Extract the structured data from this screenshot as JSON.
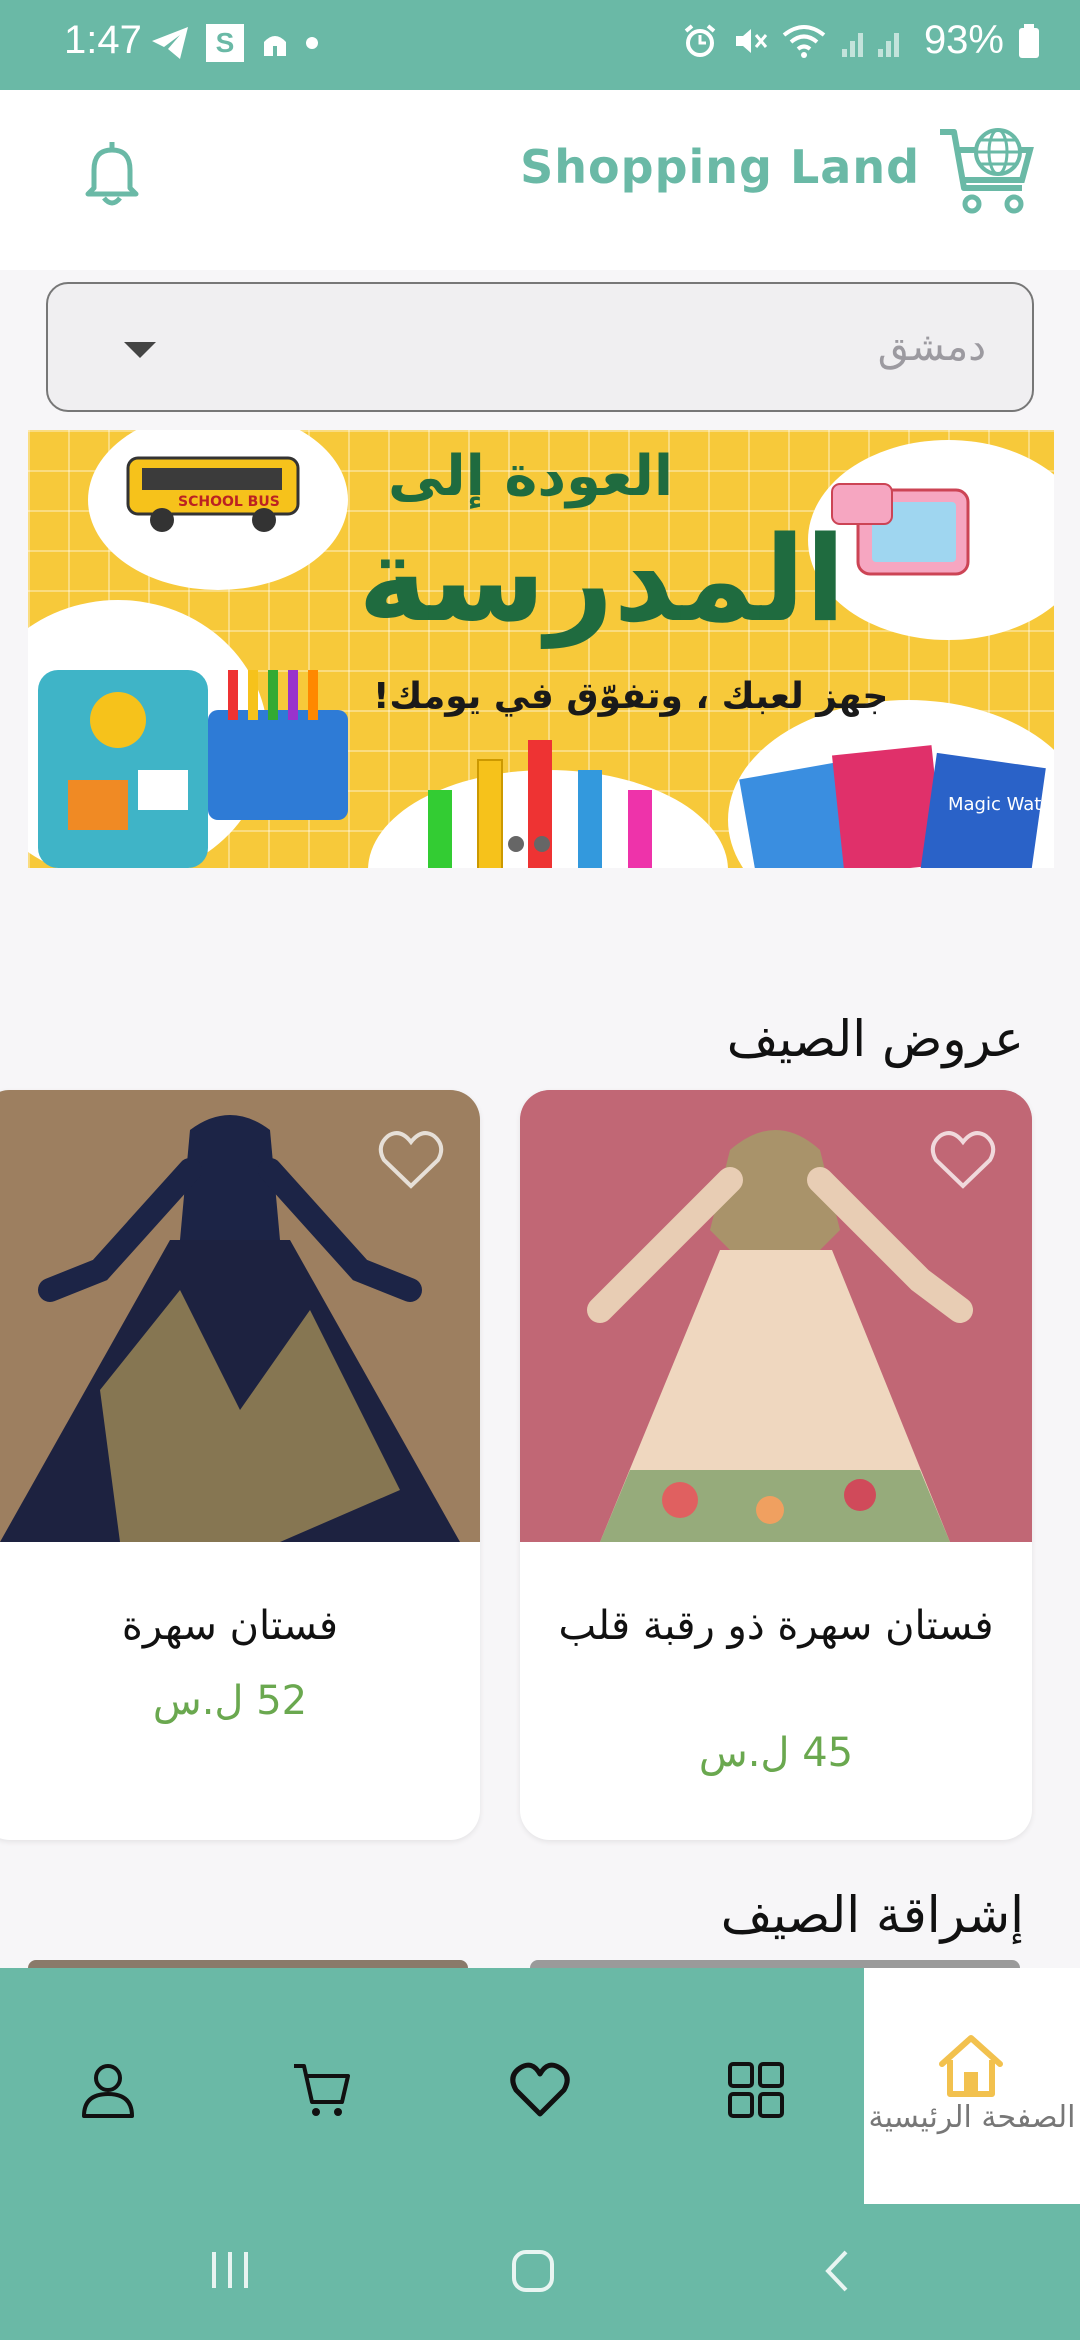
{
  "status_bar": {
    "time": "1:47",
    "battery": "93%",
    "icons": [
      "telegram-icon",
      "s-app-icon",
      "mosque-icon",
      "dot-icon",
      "alarm-icon",
      "mute-icon",
      "wifi-icon",
      "signal-icon",
      "battery-icon"
    ]
  },
  "header": {
    "brand": "Shopping Land",
    "icons": [
      "bell-icon",
      "cart-globe-logo"
    ]
  },
  "city_select": {
    "value": "دمشق"
  },
  "banner": {
    "line1": "العودة إلى",
    "line2": "المدرسة",
    "line3": "جهز لعبك ، وتفوّق في يومك!",
    "bus_label": "SCHOOL BUS",
    "book_label": "Magic Water Book"
  },
  "sections": [
    {
      "title": "عروض الصيف",
      "products": [
        {
          "name": "فستان سهرة ذو رقبة قلب",
          "price": "45 ل.س"
        },
        {
          "name": "فستان سهرة",
          "price": "52 ل.س"
        }
      ]
    },
    {
      "title": "إشراقة الصيف"
    }
  ],
  "bottom_nav": {
    "home_label": "الصفحة الرئيسية",
    "items": [
      "home-icon",
      "grid-icon",
      "heart-icon",
      "cart-icon",
      "user-icon"
    ]
  },
  "colors": {
    "accent": "#6ab9a6",
    "price": "#6aa84f",
    "home_icon": "#f2c14e"
  }
}
